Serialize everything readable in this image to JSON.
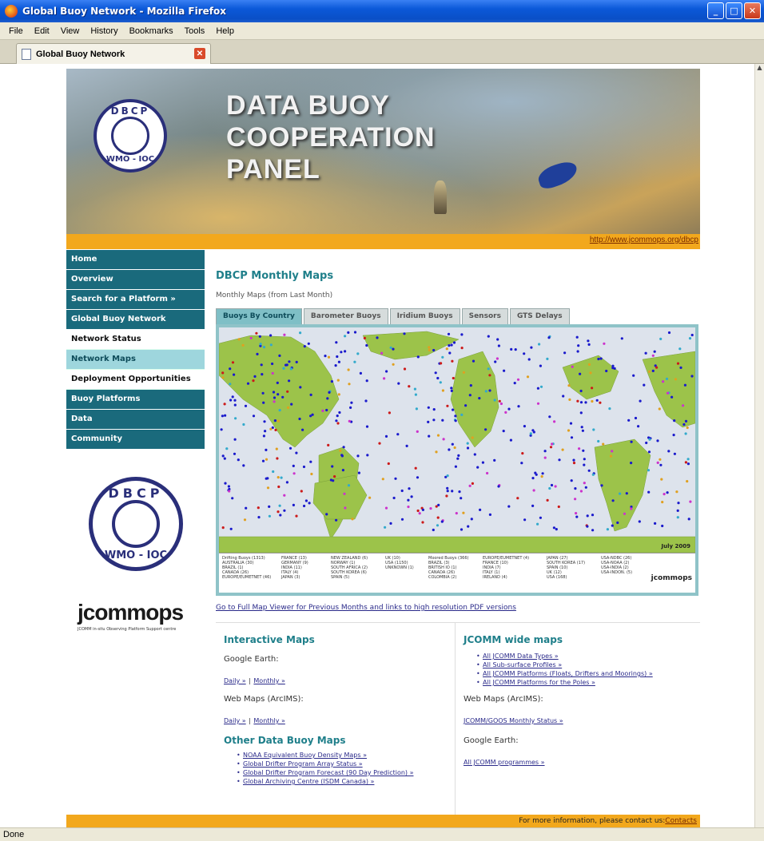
{
  "window": {
    "title": "Global Buoy Network - Mozilla Firefox"
  },
  "menubar": [
    "File",
    "Edit",
    "View",
    "History",
    "Bookmarks",
    "Tools",
    "Help"
  ],
  "browser_tab": {
    "label": "Global Buoy Network"
  },
  "status": "Done",
  "banner": {
    "title_lines": [
      "DATA BUOY",
      "COOPERATION",
      "PANEL"
    ],
    "logo_top": "DBCP",
    "logo_bottom": "WMO - IOC",
    "url": "http://www.jcommops.org/dbcp"
  },
  "sidebar": {
    "items": [
      {
        "label": "Home"
      },
      {
        "label": "Overview"
      },
      {
        "label": "Search for a Platform »"
      },
      {
        "label": "Global Buoy Network"
      },
      {
        "label": "Network Status"
      },
      {
        "label": "Network Maps"
      },
      {
        "label": "Deployment Opportunities"
      },
      {
        "label": "Buoy Platforms"
      },
      {
        "label": "Data"
      },
      {
        "label": "Community"
      }
    ],
    "logo_top": "DBCP",
    "logo_bottom": "WMO - IOC",
    "jcomm_word": "jcommops",
    "jcomm_sub": "JCOMM in-situ Observing Platform Support centre"
  },
  "main": {
    "heading": "DBCP Monthly Maps",
    "subheading": "Monthly Maps (from Last Month)",
    "map_tabs": [
      "Buoys By Country",
      "Barometer Buoys",
      "Iridium Buoys",
      "Sensors",
      "GTS Delays"
    ],
    "map_date": "July 2009",
    "map_logo": "jcommops",
    "legend": [
      [
        "Drifting Buoys (1313)",
        "AUSTRALIA (30)",
        "BRAZIL (1)",
        "CANADA (26)",
        "EUROPE/EUMETNET (46)"
      ],
      [
        "FRANCE (13)",
        "GERMANY (9)",
        "INDIA (11)",
        "ITALY (4)",
        "JAPAN (3)"
      ],
      [
        "NEW ZEALAND (6)",
        "NORWAY (1)",
        "SOUTH AFRICA (2)",
        "SOUTH KOREA (6)",
        "SPAIN (5)"
      ],
      [
        "UK (10)",
        "USA (1150)",
        "UNKNOWN (1)"
      ],
      [
        "Moored Buoys (366)",
        "BRAZIL (3)",
        "BRITISH IO (1)",
        "CANADA (26)",
        "COLOMBIA (2)"
      ],
      [
        "EUROPE/EUMETNET (4)",
        "FRANCE (10)",
        "INDIA (7)",
        "ITALY (1)",
        "IRELAND (4)"
      ],
      [
        "JAPAN (27)",
        "SOUTH KOREA (17)",
        "SPAIN (10)",
        "UK (12)",
        "USA (168)"
      ],
      [
        "USA-NDBC (26)",
        "USA-NOAA (2)",
        "USA-INDIA (2)",
        "USA-INDON. (5)"
      ]
    ],
    "full_map_link": "Go to Full Map Viewer for Previous Months and links to high resolution PDF versions",
    "interactive": {
      "heading": "Interactive Maps",
      "google_earth": "Google Earth:",
      "ge_daily": "Daily »",
      "ge_sep": "|",
      "ge_monthly": "Monthly »",
      "web_maps": "Web Maps (ArcIMS):",
      "wm_daily": "Daily »",
      "wm_sep": "|",
      "wm_monthly": "Monthly »"
    },
    "other": {
      "heading": "Other Data Buoy Maps",
      "links": [
        "NOAA Equivalent Buoy Density Maps »",
        "Global Drifter Program Array Status »",
        "Global Drifter Program Forecast (90 Day Prediction) »",
        "Global Archiving Centre (ISDM Canada) »"
      ]
    },
    "jcomm": {
      "heading": "JCOMM wide maps",
      "links": [
        "All JCOMM Data Types »",
        "All Sub-surface Profiles »",
        "All JCOMM Platforms (Floats, Drifters and Moorings) »",
        "All JCOMM Platforms for the Poles »"
      ],
      "web_maps": "Web Maps (ArcIMS):",
      "status_link": "JCOMM/GOOS Monthly Status »",
      "google_earth": "Google Earth:",
      "programmes_link": "All JCOMM programmes »"
    }
  },
  "footer": {
    "text": "For more information, please contact us:",
    "link": "Contacts"
  }
}
